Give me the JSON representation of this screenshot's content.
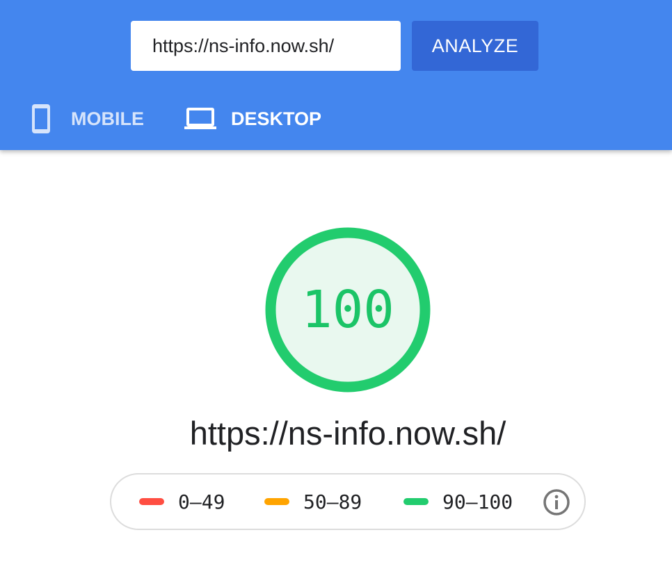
{
  "header": {
    "url_input": {
      "value": "https://ns-info.now.sh/"
    },
    "analyze_label": "ANALYZE",
    "tabs": [
      {
        "label": "MOBILE",
        "icon": "smartphone-icon",
        "selected": false
      },
      {
        "label": "DESKTOP",
        "icon": "laptop-icon",
        "selected": true
      }
    ]
  },
  "report": {
    "score": "100",
    "url": "https://ns-info.now.sh/",
    "score_color": "#1bc467"
  },
  "legend": {
    "items": [
      {
        "label": "0–49",
        "color": "#ff4e42"
      },
      {
        "label": "50–89",
        "color": "#ffa400"
      },
      {
        "label": "90–100",
        "color": "#1bc467"
      }
    ],
    "info_icon": "info-icon"
  },
  "colors": {
    "header_bg": "#4486ee",
    "analyze_bg": "#3367d6"
  }
}
